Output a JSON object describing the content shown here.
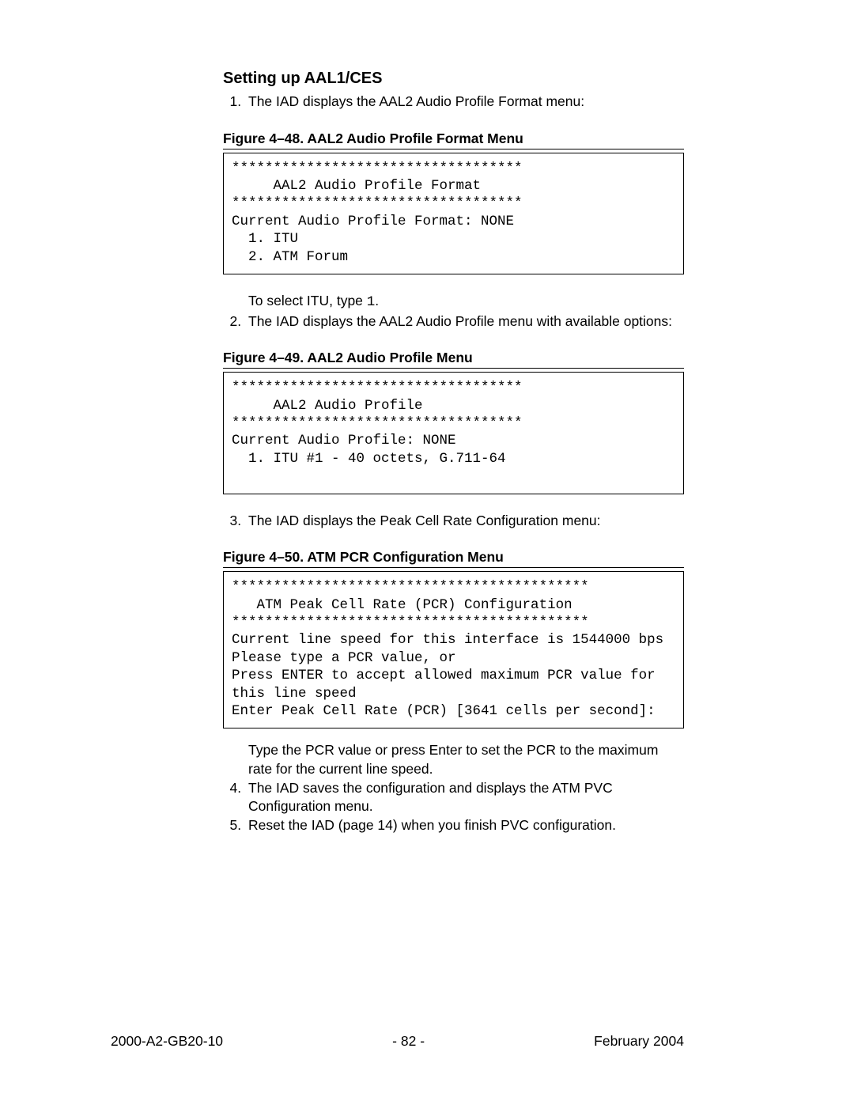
{
  "section_title": "Setting up AAL1/CES",
  "steps": {
    "s1": "The IAD displays the AAL2 Audio Profile Format menu:",
    "s1b_pre": "To select ITU, type ",
    "s1b_code": "1",
    "s1b_post": ".",
    "s2": "The IAD displays the AAL2 Audio Profile menu with available options:",
    "s3": "The IAD displays the Peak Cell Rate Configuration menu:",
    "s3b": "Type the PCR value or press Enter to set the PCR to the maximum rate for the current line speed.",
    "s4": "The IAD saves the configuration and displays the ATM PVC Configuration menu.",
    "s5": "Reset the IAD (page 14) when you finish PVC configuration."
  },
  "figures": {
    "f48_caption": "Figure 4–48.  AAL2 Audio Profile Format Menu",
    "f48_code": "***********************************\n     AAL2 Audio Profile Format\n***********************************\nCurrent Audio Profile Format: NONE\n  1. ITU\n  2. ATM Forum",
    "f49_caption": "Figure 4–49.  AAL2 Audio Profile Menu",
    "f49_code": "***********************************\n     AAL2 Audio Profile\n***********************************\nCurrent Audio Profile: NONE\n  1. ITU #1 - 40 octets, G.711-64\n ",
    "f50_caption": "Figure 4–50.  ATM PCR Configuration Menu",
    "f50_code": "*******************************************\n   ATM Peak Cell Rate (PCR) Configuration\n*******************************************\nCurrent line speed for this interface is 1544000 bps\nPlease type a PCR value, or\nPress ENTER to accept allowed maximum PCR value for\nthis line speed\nEnter Peak Cell Rate (PCR) [3641 cells per second]:"
  },
  "footer": {
    "left": "2000-A2-GB20-10",
    "center": "- 82 -",
    "right": "February 2004"
  }
}
